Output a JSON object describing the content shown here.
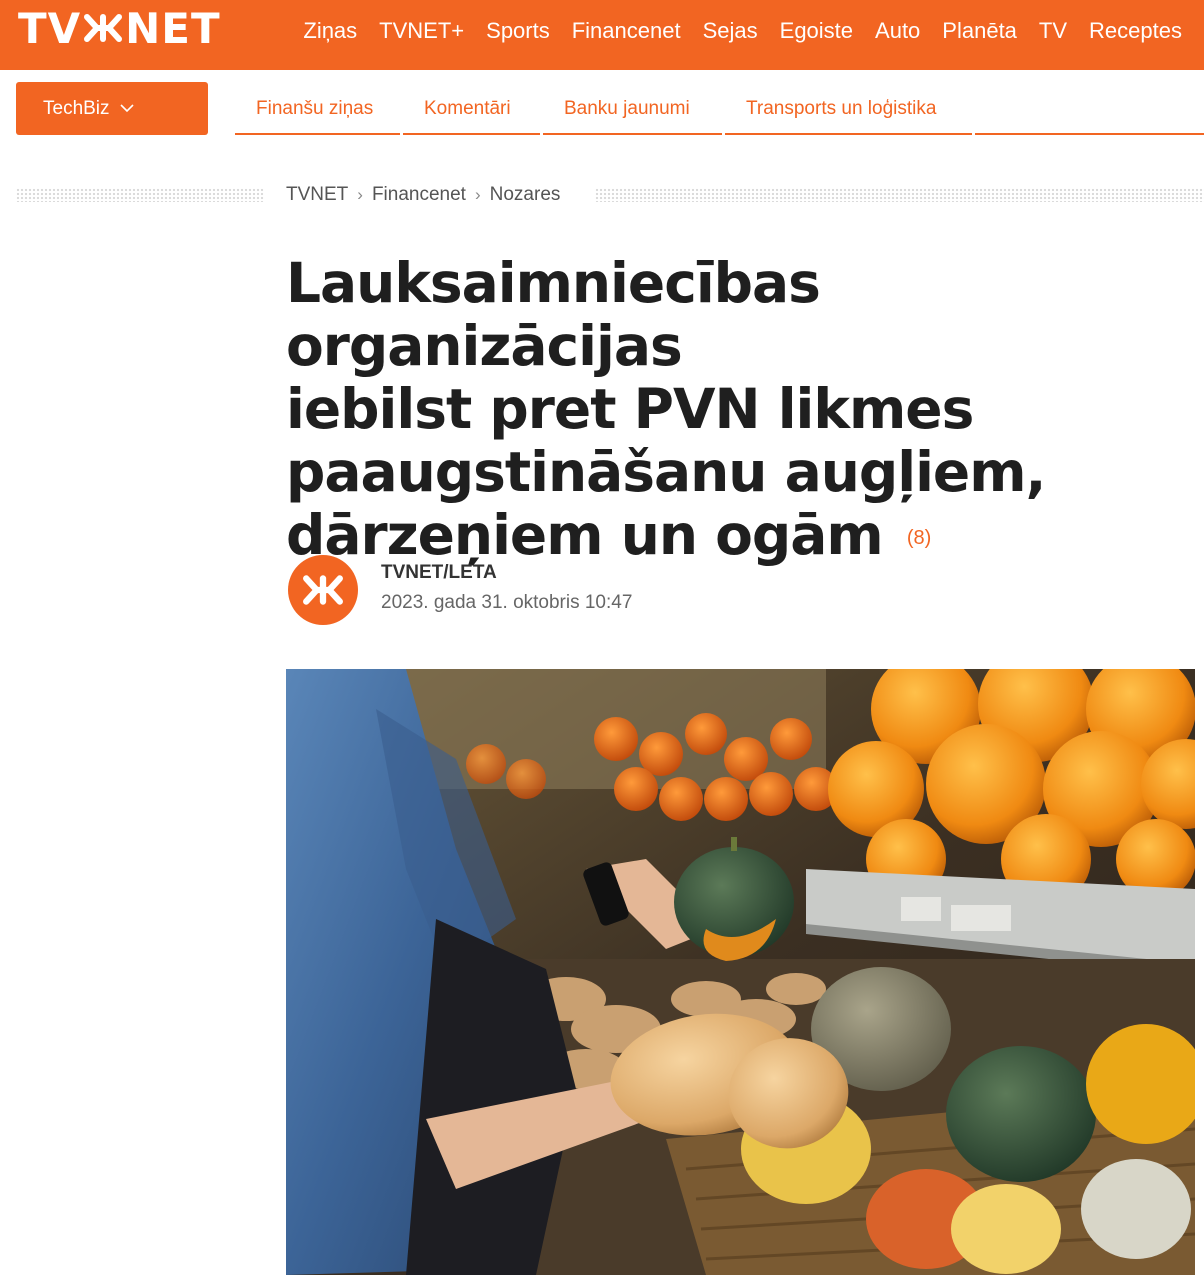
{
  "site": {
    "logo_text_left": "TV",
    "logo_text_right": "NET",
    "brand_color": "#f26522"
  },
  "main_nav": [
    "Ziņas",
    "TVNET+",
    "Sports",
    "Financenet",
    "Sejas",
    "Egoiste",
    "Auto",
    "Planēta",
    "TV",
    "Receptes"
  ],
  "section": {
    "label": "TechBiz",
    "icon": "chevron-down-icon"
  },
  "sub_nav": [
    "Finanšu ziņas",
    "Komentāri",
    "Banku jaunumi",
    "Transports un loģistika"
  ],
  "breadcrumb": [
    "TVNET",
    "Financenet",
    "Nozares"
  ],
  "article": {
    "title_lines": [
      "Lauksaimniecības organizācijas",
      "iebilst pret PVN likmes",
      "paaugstināšanu augļiem,",
      "dārzeņiem un ogām"
    ],
    "comment_count": "(8)",
    "author": "TVNET/LETA",
    "date": "2023. gada 31. oktobris 10:47",
    "image_alt": "Woman choosing pumpkins and squash in a supermarket produce section"
  }
}
